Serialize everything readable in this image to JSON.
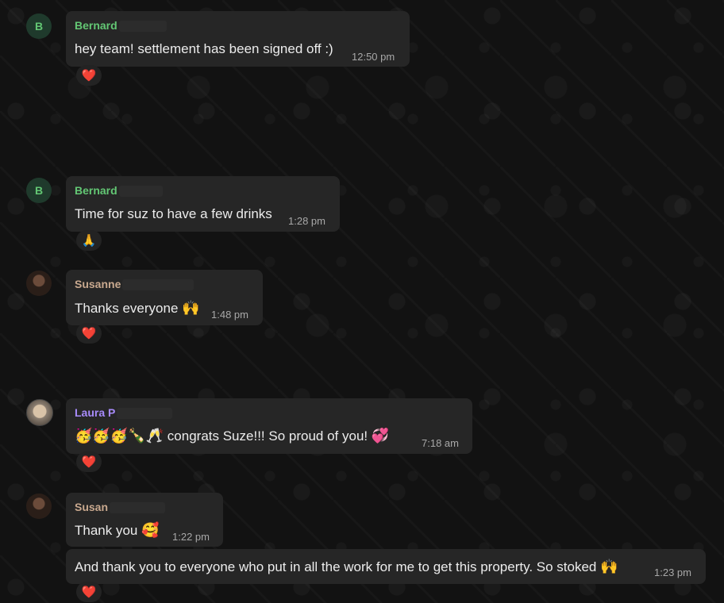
{
  "messages": [
    {
      "sender": "Bernard",
      "sender_color": "#63c774",
      "avatar_letter": "B",
      "text": "hey team! settlement has been signed off :)",
      "time": "12:50 pm",
      "reaction": "❤️"
    },
    {
      "sender": "Bernard",
      "sender_color": "#63c774",
      "avatar_letter": "B",
      "text": "Time for suz to have a few drinks",
      "time": "1:28 pm",
      "reaction": "🙏"
    },
    {
      "sender": "Susanne",
      "sender_color": "#c9a98f",
      "text": "Thanks everyone",
      "emoji": "🙌",
      "time": "1:48 pm",
      "reaction": "❤️"
    },
    {
      "sender": "Laura P",
      "sender_color": "#a78bfa",
      "emojis_before": "🥳🥳🥳🍾🥂",
      "text": "congrats Suze!!! So proud of you!",
      "emoji": "💞",
      "time": "7:18 am",
      "reaction": "❤️"
    },
    {
      "sender": "Susan",
      "sender_color": "#c9a98f",
      "text": "Thank you",
      "emoji": "🥰",
      "time": "1:22 pm"
    },
    {
      "text": "And thank you to everyone who put in all the work for me to get this property. So stoked",
      "emoji": "🙌",
      "time": "1:23 pm",
      "reaction": "❤️"
    }
  ]
}
